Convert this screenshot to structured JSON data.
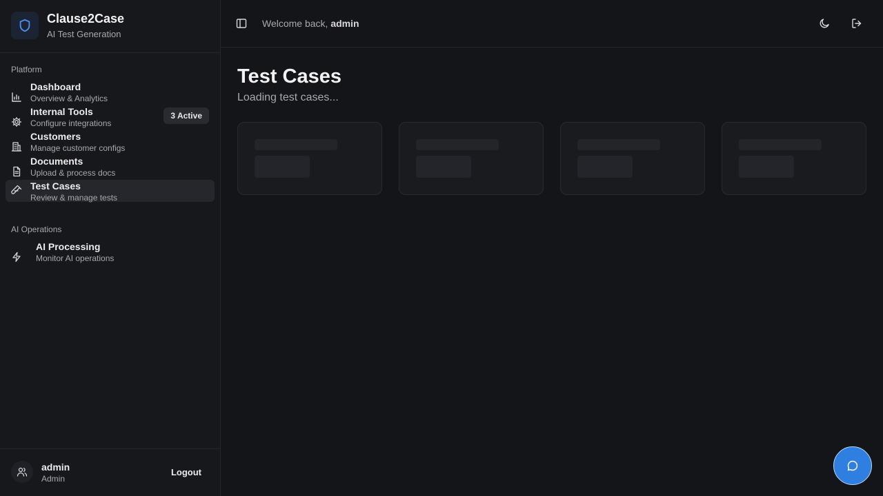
{
  "brand": {
    "name": "Clause2Case",
    "subtitle": "AI Test Generation"
  },
  "sidebar": {
    "sections": [
      {
        "label": "Platform",
        "items": [
          {
            "title": "Dashboard",
            "subtitle": "Overview & Analytics",
            "icon": "bar-chart-icon"
          },
          {
            "title": "Internal Tools",
            "subtitle": "Configure integrations",
            "icon": "gear-icon",
            "badge": "3 Active"
          },
          {
            "title": "Customers",
            "subtitle": "Manage customer configs",
            "icon": "building-icon"
          },
          {
            "title": "Documents",
            "subtitle": "Upload & process docs",
            "icon": "document-icon"
          },
          {
            "title": "Test Cases",
            "subtitle": "Review & manage tests",
            "icon": "test-tube-icon",
            "active": true
          }
        ]
      },
      {
        "label": "AI Operations",
        "items": [
          {
            "title": "AI Processing",
            "subtitle": "Monitor AI operations",
            "icon": "lightning-icon"
          }
        ]
      }
    ],
    "user": {
      "name": "admin",
      "role": "Admin",
      "logout_label": "Logout"
    }
  },
  "header": {
    "welcome_prefix": "Welcome back,",
    "username": "admin"
  },
  "main": {
    "title": "Test Cases",
    "subtitle": "Loading test cases..."
  },
  "colors": {
    "accent": "#2f7fe0",
    "background": "#141519",
    "sidebar": "#17181c"
  }
}
